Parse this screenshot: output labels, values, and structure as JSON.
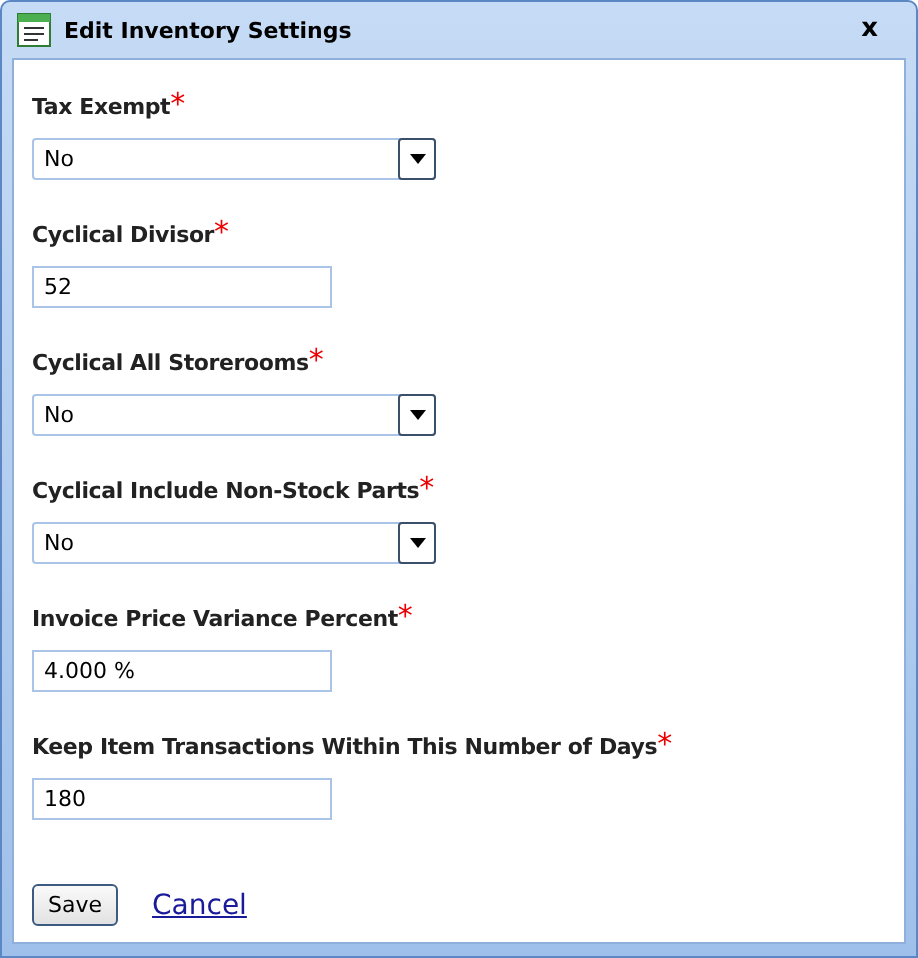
{
  "window": {
    "title": "Edit Inventory Settings",
    "close": "x"
  },
  "fields": [
    {
      "kind": "select",
      "label": "Tax Exempt",
      "required_mark": "*",
      "value": "No"
    },
    {
      "kind": "text",
      "label": "Cyclical Divisor",
      "required_mark": "*",
      "value": "52"
    },
    {
      "kind": "select",
      "label": "Cyclical All Storerooms",
      "required_mark": "*",
      "value": "No"
    },
    {
      "kind": "select",
      "label": "Cyclical Include Non-Stock Parts",
      "required_mark": "*",
      "value": "No"
    },
    {
      "kind": "text",
      "label": "Invoice Price Variance Percent",
      "required_mark": "*",
      "value": "4.000 %"
    },
    {
      "kind": "text",
      "label": "Keep Item Transactions Within This Number of Days",
      "required_mark": "*",
      "value": "180"
    }
  ],
  "buttons": {
    "save": "Save",
    "cancel": "Cancel"
  }
}
